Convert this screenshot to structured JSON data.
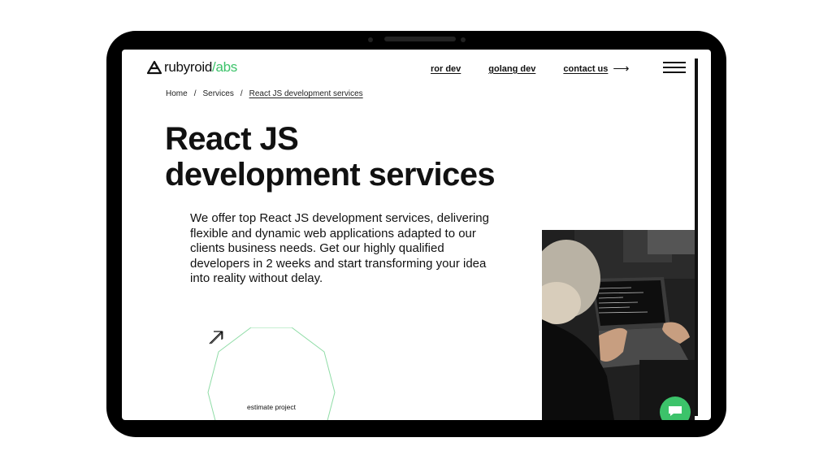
{
  "header": {
    "logo_main": "rubyroid",
    "logo_accent": "/abs",
    "nav": [
      {
        "label": "ror dev"
      },
      {
        "label": "golang dev"
      },
      {
        "label": "contact us"
      }
    ],
    "contact_arrow": "⟶"
  },
  "breadcrumb": {
    "items": [
      "Home",
      "Services",
      "React JS development services"
    ],
    "separator": "/"
  },
  "hero": {
    "title_line1": "React JS",
    "title_line2": "development services",
    "description": "We offer top React JS development services, delivering flexible and dynamic web applications adapted to our clients business needs. Get our highly qualified developers in 2 weeks and start transforming your idea into reality without delay."
  },
  "estimate": {
    "label": "estimate project"
  },
  "colors": {
    "accent": "#3cc36a",
    "frame": "#000000",
    "text": "#111111"
  },
  "icons": [
    "logo-mark-icon",
    "arrow-right-icon",
    "menu-icon",
    "arrow-up-right-icon",
    "chat-icon"
  ]
}
